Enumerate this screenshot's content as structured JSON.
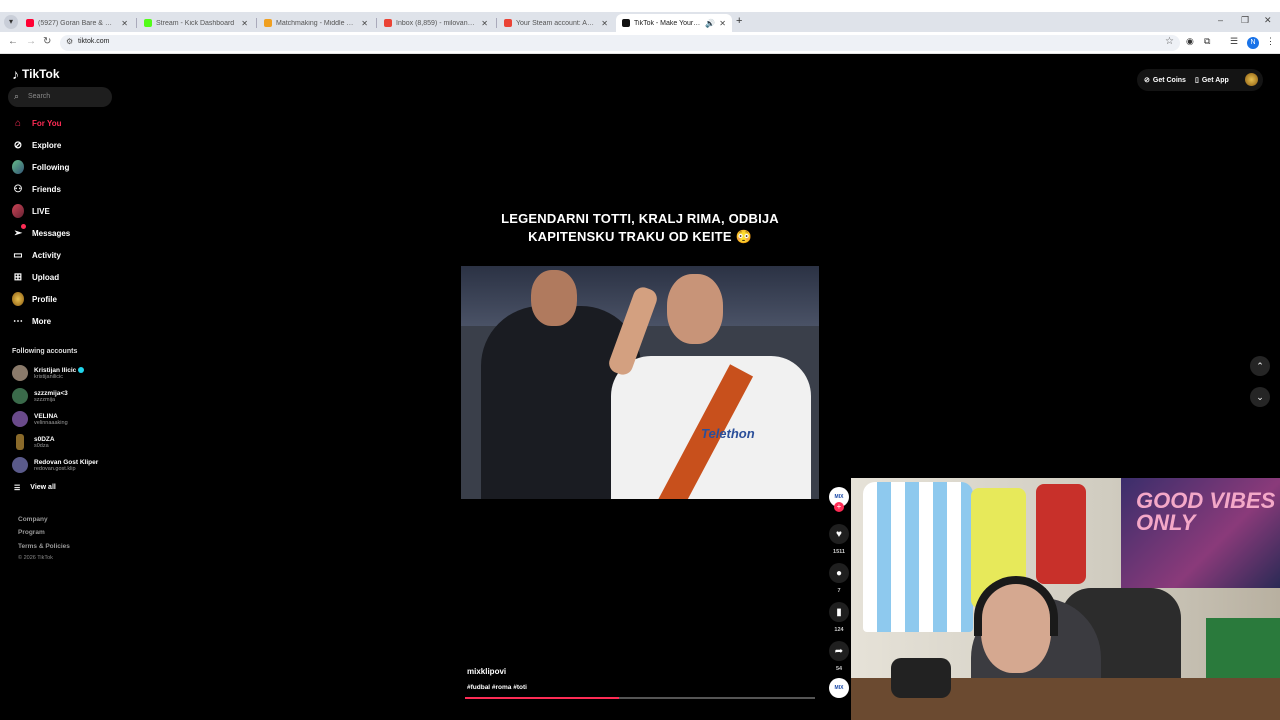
{
  "browser": {
    "tabs": [
      {
        "title": "(5927) Goran Bare & Majke - Ti",
        "color": "#ff0033"
      },
      {
        "title": "Stream - Kick Dashboard",
        "color": "#53fc18"
      },
      {
        "title": "Matchmaking - Middle East Se",
        "color": "#f0a020"
      },
      {
        "title": "Inbox (8,859) - milovanovicnem",
        "color": "#ea4335"
      },
      {
        "title": "Your Steam account: Access fro",
        "color": "#ea4335"
      },
      {
        "title": "TikTok - Make Your Day",
        "color": "#111111"
      }
    ],
    "url": "tiktok.com",
    "profile_initial": "N"
  },
  "tiktok": {
    "logo": "TikTok",
    "search_placeholder": "Search",
    "nav": [
      {
        "label": "For You",
        "icon": "home-icon"
      },
      {
        "label": "Explore",
        "icon": "compass-icon"
      },
      {
        "label": "Following",
        "icon": "following-icon"
      },
      {
        "label": "Friends",
        "icon": "friends-icon"
      },
      {
        "label": "LIVE",
        "icon": "live-icon"
      },
      {
        "label": "Messages",
        "icon": "messages-icon"
      },
      {
        "label": "Activity",
        "icon": "activity-icon"
      },
      {
        "label": "Upload",
        "icon": "upload-icon"
      },
      {
        "label": "Profile",
        "icon": "profile-icon"
      },
      {
        "label": "More",
        "icon": "more-icon"
      }
    ],
    "following_title": "Following accounts",
    "accounts": [
      {
        "name": "Kristijan Ilicic",
        "handle": "kristijanilicic",
        "verified": true
      },
      {
        "name": "szzzmija<3",
        "handle": "szzzmija",
        "verified": false
      },
      {
        "name": "VELINA",
        "handle": "velinnaaaking",
        "verified": false
      },
      {
        "name": "s0DZA",
        "handle": "s0dza",
        "verified": false
      },
      {
        "name": "Redovan Gost Kliper",
        "handle": "redovan.gost.klip",
        "verified": false
      }
    ],
    "view_all": "View all",
    "footer": {
      "company": "Company",
      "program": "Program",
      "terms": "Terms & Policies",
      "copyright": "© 2026 TikTok"
    },
    "header": {
      "coins": "Get Coins",
      "app": "Get App"
    },
    "video": {
      "caption_line1": "LEGENDARNI TOTTI, KRALJ RIMA, ODBIJA",
      "caption_line2": "KAPITENSKU TRAKU OD KEITE 😳",
      "sponsor": "Telethon",
      "author": "mixklipovi",
      "tags": "#fudbal #roma #toti",
      "progress": 0.44,
      "likes": "1511",
      "comments": "7",
      "saves": "124",
      "shares": "54",
      "channel_badge": "MIX"
    }
  },
  "webcam": {
    "flag_text": "GOOD VIBES ONLY"
  }
}
